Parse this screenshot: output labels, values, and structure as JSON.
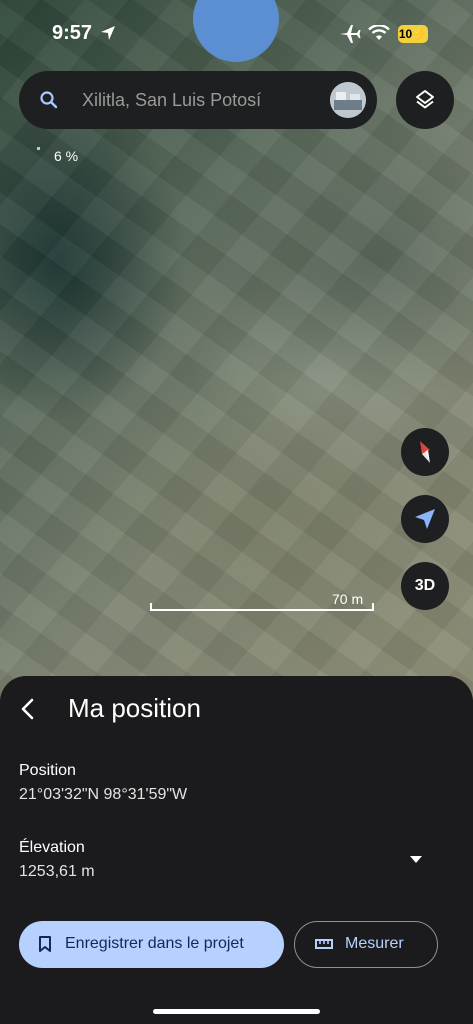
{
  "status_bar": {
    "time": "9:57",
    "battery": "10"
  },
  "search": {
    "placeholder": "Xilitla, San Luis Potosí"
  },
  "map": {
    "loading_percent": "6 %",
    "scale_label": "70 m",
    "three_d_label": "3D"
  },
  "sheet": {
    "title": "Ma position",
    "position_label": "Position",
    "position_value": "21°03'32\"N 98°31'59\"W",
    "elevation_label": "Élevation",
    "elevation_value": "1253,61 m",
    "save_button": "Enregistrer dans le projet",
    "measure_button": "Mesurer"
  },
  "icons": {
    "search": "search-icon",
    "layers": "layers-icon",
    "compass": "compass-icon",
    "my_location": "navigation-arrow-icon",
    "back": "back-arrow-icon",
    "expand": "triangle-down-icon",
    "bookmark": "bookmark-icon",
    "ruler": "ruler-icon"
  },
  "colors": {
    "accent": "#b7d1ff",
    "sheet_bg": "#1b1b1d",
    "compass_red": "#e0463b",
    "location_blue": "#8ab4f8",
    "battery": "#f4d03f"
  }
}
